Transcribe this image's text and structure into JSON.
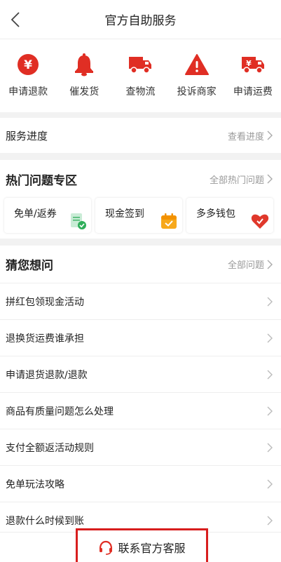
{
  "header": {
    "title": "官方自助服务",
    "back_icon": "chevron-left-icon"
  },
  "services": [
    {
      "label": "申请退款",
      "icon": "yen-coin-icon"
    },
    {
      "label": "催发货",
      "icon": "bell-icon"
    },
    {
      "label": "查物流",
      "icon": "truck-icon"
    },
    {
      "label": "投诉商家",
      "icon": "warning-icon"
    },
    {
      "label": "申请运费",
      "icon": "yen-truck-icon"
    }
  ],
  "progress": {
    "title": "服务进度",
    "link": "查看进度"
  },
  "hot": {
    "title": "热门问题专区",
    "link": "全部热门问题",
    "cards": [
      {
        "label": "免单/返券",
        "icon": "coupon-check-icon"
      },
      {
        "label": "现金签到",
        "icon": "calendar-icon"
      },
      {
        "label": "多多钱包",
        "icon": "wallet-heart-icon"
      }
    ]
  },
  "guess": {
    "title": "猜您想问",
    "link": "全部问题",
    "items": [
      "拼红包领现金活动",
      "退换货运费谁承担",
      "申请退货退款/退款",
      "商品有质量问题怎么处理",
      "支付全额返活动规则",
      "免单玩法攻略",
      "退款什么时候到账"
    ]
  },
  "footer": {
    "contact_label": "联系官方客服",
    "contact_icon": "headset-icon"
  },
  "colors": {
    "accent": "#e02e24",
    "highlight_border": "#d81e1e"
  }
}
